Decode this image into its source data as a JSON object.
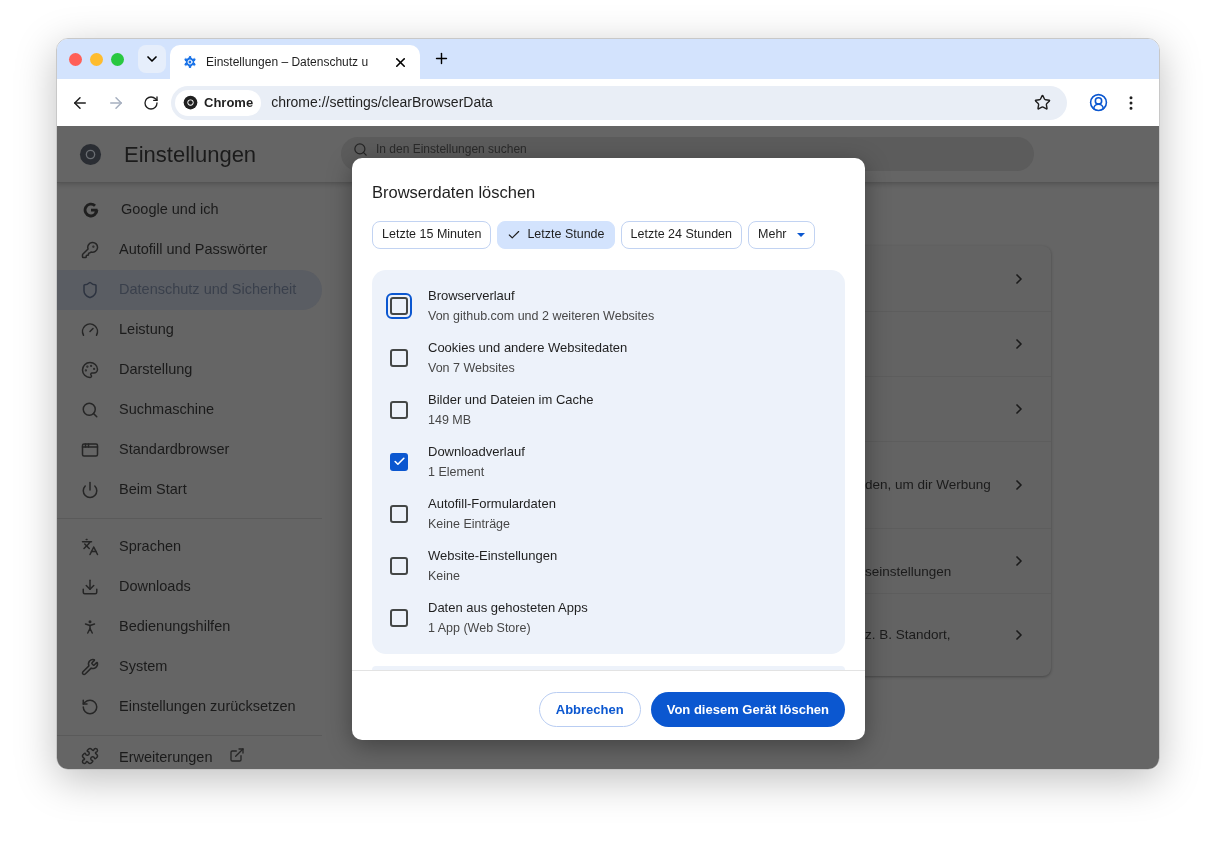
{
  "window": {
    "tabs": [
      {
        "title": "Einstellungen – Datenschutz u",
        "selected": true
      }
    ]
  },
  "toolbar": {
    "forward_disabled": true,
    "chip": "Chrome",
    "url": "chrome://settings/clearBrowserData"
  },
  "settings": {
    "title": "Einstellungen",
    "search_placeholder": "In den Einstellungen suchen",
    "sidebar": [
      [
        {
          "label": "Google und ich",
          "selected": false
        },
        {
          "label": "Autofill und Passwörter",
          "selected": false
        },
        {
          "label": "Datenschutz und Sicherheit",
          "selected": true
        },
        {
          "label": "Leistung",
          "selected": false
        },
        {
          "label": "Darstellung",
          "selected": false
        },
        {
          "label": "Suchmaschine",
          "selected": false
        },
        {
          "label": "Standardbrowser",
          "selected": false
        },
        {
          "label": "Beim Start",
          "selected": false
        }
      ],
      [
        {
          "label": "Sprachen",
          "selected": false
        },
        {
          "label": "Downloads",
          "selected": false
        },
        {
          "label": "Bedienungshilfen",
          "selected": false
        },
        {
          "label": "System",
          "selected": false
        },
        {
          "label": "Einstellungen zurücksetzen",
          "selected": false
        }
      ],
      [
        {
          "label": "Erweiterungen",
          "selected": false
        }
      ]
    ],
    "card_rows": [
      {
        "kind": "plain"
      },
      {
        "kind": "plain"
      },
      {
        "kind": "plain"
      },
      {
        "kind": "text",
        "text": "den, um dir Werbung"
      },
      {
        "kind": "text",
        "text": "seinstellungen"
      },
      {
        "kind": "text",
        "text": "z. B. Standort,"
      }
    ]
  },
  "dialog": {
    "title": "Browserdaten löschen",
    "ranges": [
      {
        "label": "Letzte 15 Minuten",
        "selected": false
      },
      {
        "label": "Letzte Stunde",
        "selected": true
      },
      {
        "label": "Letzte 24 Stunden",
        "selected": false
      }
    ],
    "more": "Mehr",
    "items": [
      {
        "title": "Browserverlauf",
        "subtitle": "Von github.com und 2 weiteren Websites",
        "checked": false,
        "focused": true
      },
      {
        "title": "Cookies und andere Websitedaten",
        "subtitle": "Von 7 Websites",
        "checked": false,
        "focused": false
      },
      {
        "title": "Bilder und Dateien im Cache",
        "subtitle": "149 MB",
        "checked": false,
        "focused": false
      },
      {
        "title": "Downloadverlauf",
        "subtitle": "1 Element",
        "checked": true,
        "focused": false
      },
      {
        "title": "Autofill-Formulardaten",
        "subtitle": "Keine Einträge",
        "checked": false,
        "focused": false
      },
      {
        "title": "Website-Einstellungen",
        "subtitle": "Keine",
        "checked": false,
        "focused": false
      },
      {
        "title": "Daten aus gehosteten Apps",
        "subtitle": "1 App (Web Store)",
        "checked": false,
        "focused": false
      }
    ],
    "buttons": [
      {
        "label": "Abbrechen",
        "kind": "secondary"
      },
      {
        "label": "Von diesem Gerät löschen",
        "kind": "primary"
      }
    ]
  }
}
